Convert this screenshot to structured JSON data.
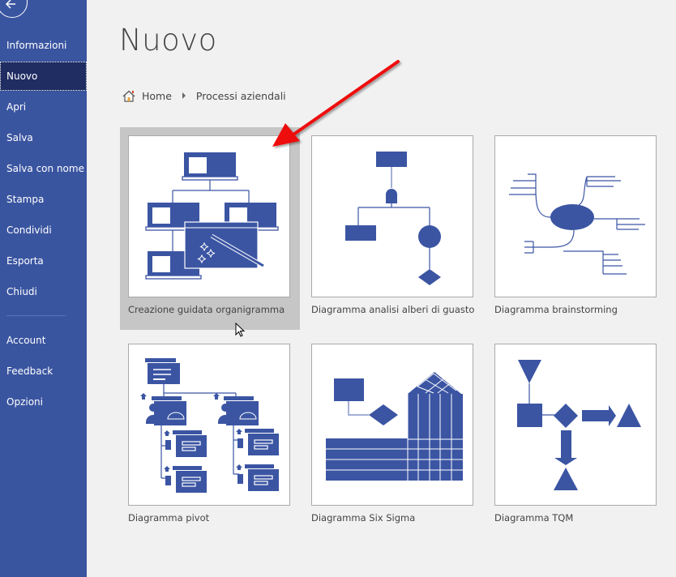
{
  "sidebar": {
    "back_icon": "back-arrow-icon",
    "items": [
      {
        "label": "Informazioni"
      },
      {
        "label": "Nuovo",
        "active": true
      },
      {
        "label": "Apri"
      },
      {
        "label": "Salva"
      },
      {
        "label": "Salva con nome"
      },
      {
        "label": "Stampa"
      },
      {
        "label": "Condividi"
      },
      {
        "label": "Esporta"
      },
      {
        "label": "Chiudi"
      }
    ],
    "bottom_items": [
      {
        "label": "Account"
      },
      {
        "label": "Feedback"
      },
      {
        "label": "Opzioni"
      }
    ],
    "color": "#3a55a0",
    "active_color": "#1f2d62"
  },
  "main": {
    "title": "Nuovo",
    "breadcrumb": {
      "home_icon": "home-icon",
      "home_label": "Home",
      "separator_icon": "caret-right-icon",
      "current": "Processi aziendali"
    },
    "templates": [
      {
        "label": "Creazione guidata organigramma",
        "icon": "org-chart-wizard",
        "selected": true
      },
      {
        "label": "Diagramma analisi alberi di guasto",
        "icon": "fault-tree"
      },
      {
        "label": "Diagramma brainstorming",
        "icon": "brainstorming"
      },
      {
        "label": "Diagramma pivot",
        "icon": "pivot"
      },
      {
        "label": "Diagramma Six Sigma",
        "icon": "six-sigma"
      },
      {
        "label": "Diagramma TQM",
        "icon": "tqm"
      }
    ],
    "accent_color": "#3b55a3"
  },
  "annotation": {
    "type": "red-arrow",
    "color": "#ee1111",
    "points_to": "Creazione guidata organigramma"
  }
}
